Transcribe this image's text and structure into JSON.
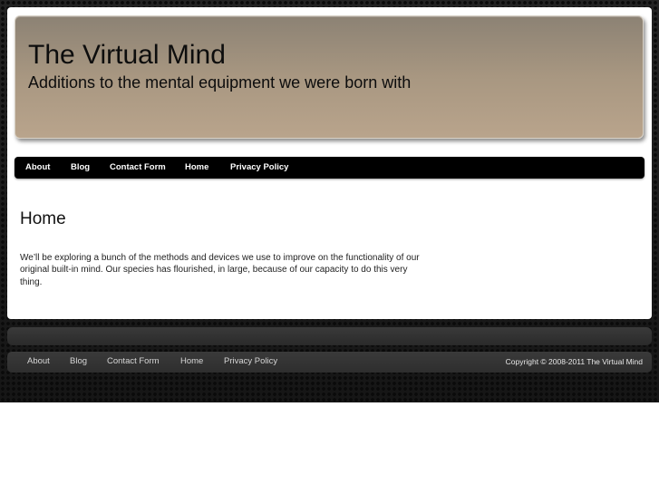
{
  "site": {
    "title": "The Virtual Mind",
    "tagline": "Additions to the mental equipment we were born with"
  },
  "nav": {
    "items": [
      {
        "label": "About"
      },
      {
        "label": "Blog"
      },
      {
        "label": "Contact Form"
      },
      {
        "label": "Home"
      },
      {
        "label": "Privacy Policy"
      }
    ]
  },
  "content": {
    "heading": "Home",
    "body": "We’ll be exploring a bunch of the methods and devices we use to improve on the functionality of our original built-in mind. Our species has flourished, in large, because of our capacity to do this very thing."
  },
  "footer": {
    "nav": [
      {
        "label": "About"
      },
      {
        "label": "Blog"
      },
      {
        "label": "Contact Form"
      },
      {
        "label": "Home"
      },
      {
        "label": "Privacy Policy"
      }
    ],
    "copyright": "Copyright © 2008-2011 The Virtual Mind"
  },
  "colors": {
    "header_gradient_top": "#8c8274",
    "header_gradient_bottom": "#b9a48c",
    "navbar": "#000000",
    "page_background": "#ffffff",
    "site_background": "#1a1a1a"
  }
}
